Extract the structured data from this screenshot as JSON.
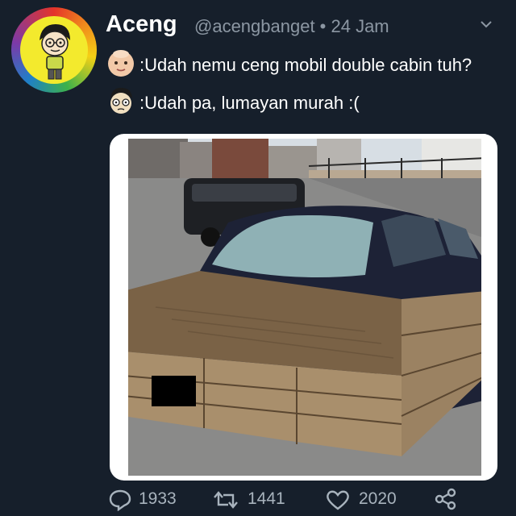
{
  "tweet": {
    "author_name": "Aceng",
    "handle_time": "@acengbanget • 24 Jam",
    "avatar_icon": "cartoon-boy-avatar",
    "messages": [
      {
        "speaker_icon": "baby-face-icon",
        "text": ":Udah nemu ceng mobil double cabin tuh?"
      },
      {
        "speaker_icon": "cartoon-face-icon",
        "text": ":Udah pa, lumayan murah :("
      }
    ],
    "media": {
      "description_icon": "sedan-with-wooden-crate-photo"
    }
  },
  "actions": {
    "replies": "1933",
    "retweets": "1441",
    "likes": "2020"
  },
  "colors": {
    "background": "#161f2b",
    "muted": "#8c97a3",
    "action_text": "#a8b3bd"
  }
}
